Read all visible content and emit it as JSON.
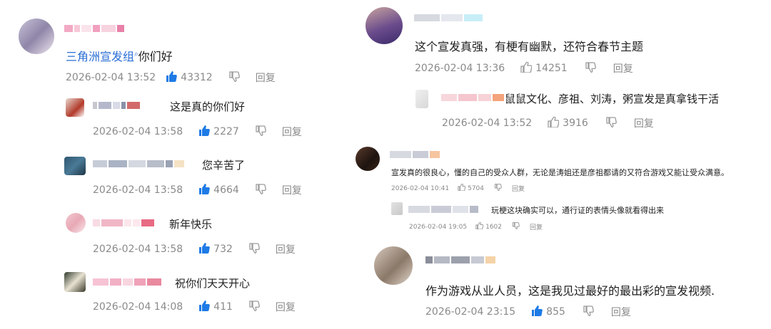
{
  "left": [
    {
      "id": "c1",
      "text_prefix": "三角洲宣发组",
      "text_suffix": "你们好",
      "date": "2026-02-04 13:52",
      "likes": "43312",
      "reply": "回复"
    },
    {
      "id": "c2",
      "text": "这是真的你们好",
      "date": "2026-02-04 13:58",
      "likes": "2227",
      "reply": "回复"
    },
    {
      "id": "c3",
      "text": "您辛苦了",
      "date": "2026-02-04 13:58",
      "likes": "4664",
      "reply": "回复"
    },
    {
      "id": "c4",
      "text": "新年快乐",
      "date": "2026-02-04 13:58",
      "likes": "732",
      "reply": "回复"
    },
    {
      "id": "c5",
      "text": "祝你们天天开心",
      "date": "2026-02-04 14:08",
      "likes": "411",
      "reply": "回复"
    }
  ],
  "right": [
    {
      "id": "r1",
      "text": "这个宣发真强，有梗有幽默，还符合春节主题",
      "date": "2026-02-04 13:36",
      "likes": "14251",
      "reply": "回复"
    },
    {
      "id": "r2",
      "text": "鼠鼠文化、彦祖、刘涛，粥宣发是真拿钱干活",
      "date": "2026-02-04 13:52",
      "likes": "3916",
      "reply": "回复"
    },
    {
      "id": "r3",
      "text": "宣发真的很良心，懂的自己的受众人群，无论是涛姐还是彦祖都请的又符合游戏又能让受众满意。",
      "date": "2026-02-04 10:41",
      "likes": "5704",
      "reply": "回复"
    },
    {
      "id": "r4",
      "text": "玩梗这块确实可以，通行证的表情头像就看得出来",
      "date": "2026-02-04 19:05",
      "likes": "1602",
      "reply": "回复"
    },
    {
      "id": "r5",
      "text": "作为游戏从业人员，这是我见过最好的最出彩的宣发视频.",
      "date": "2026-02-04 23:15",
      "likes": "855",
      "reply": "回复"
    }
  ],
  "colors": {
    "like_blue": "#1e7be6",
    "like_gray": "#9a9a9a",
    "link": "#2a6fd6",
    "meta": "#8a8a8a"
  }
}
